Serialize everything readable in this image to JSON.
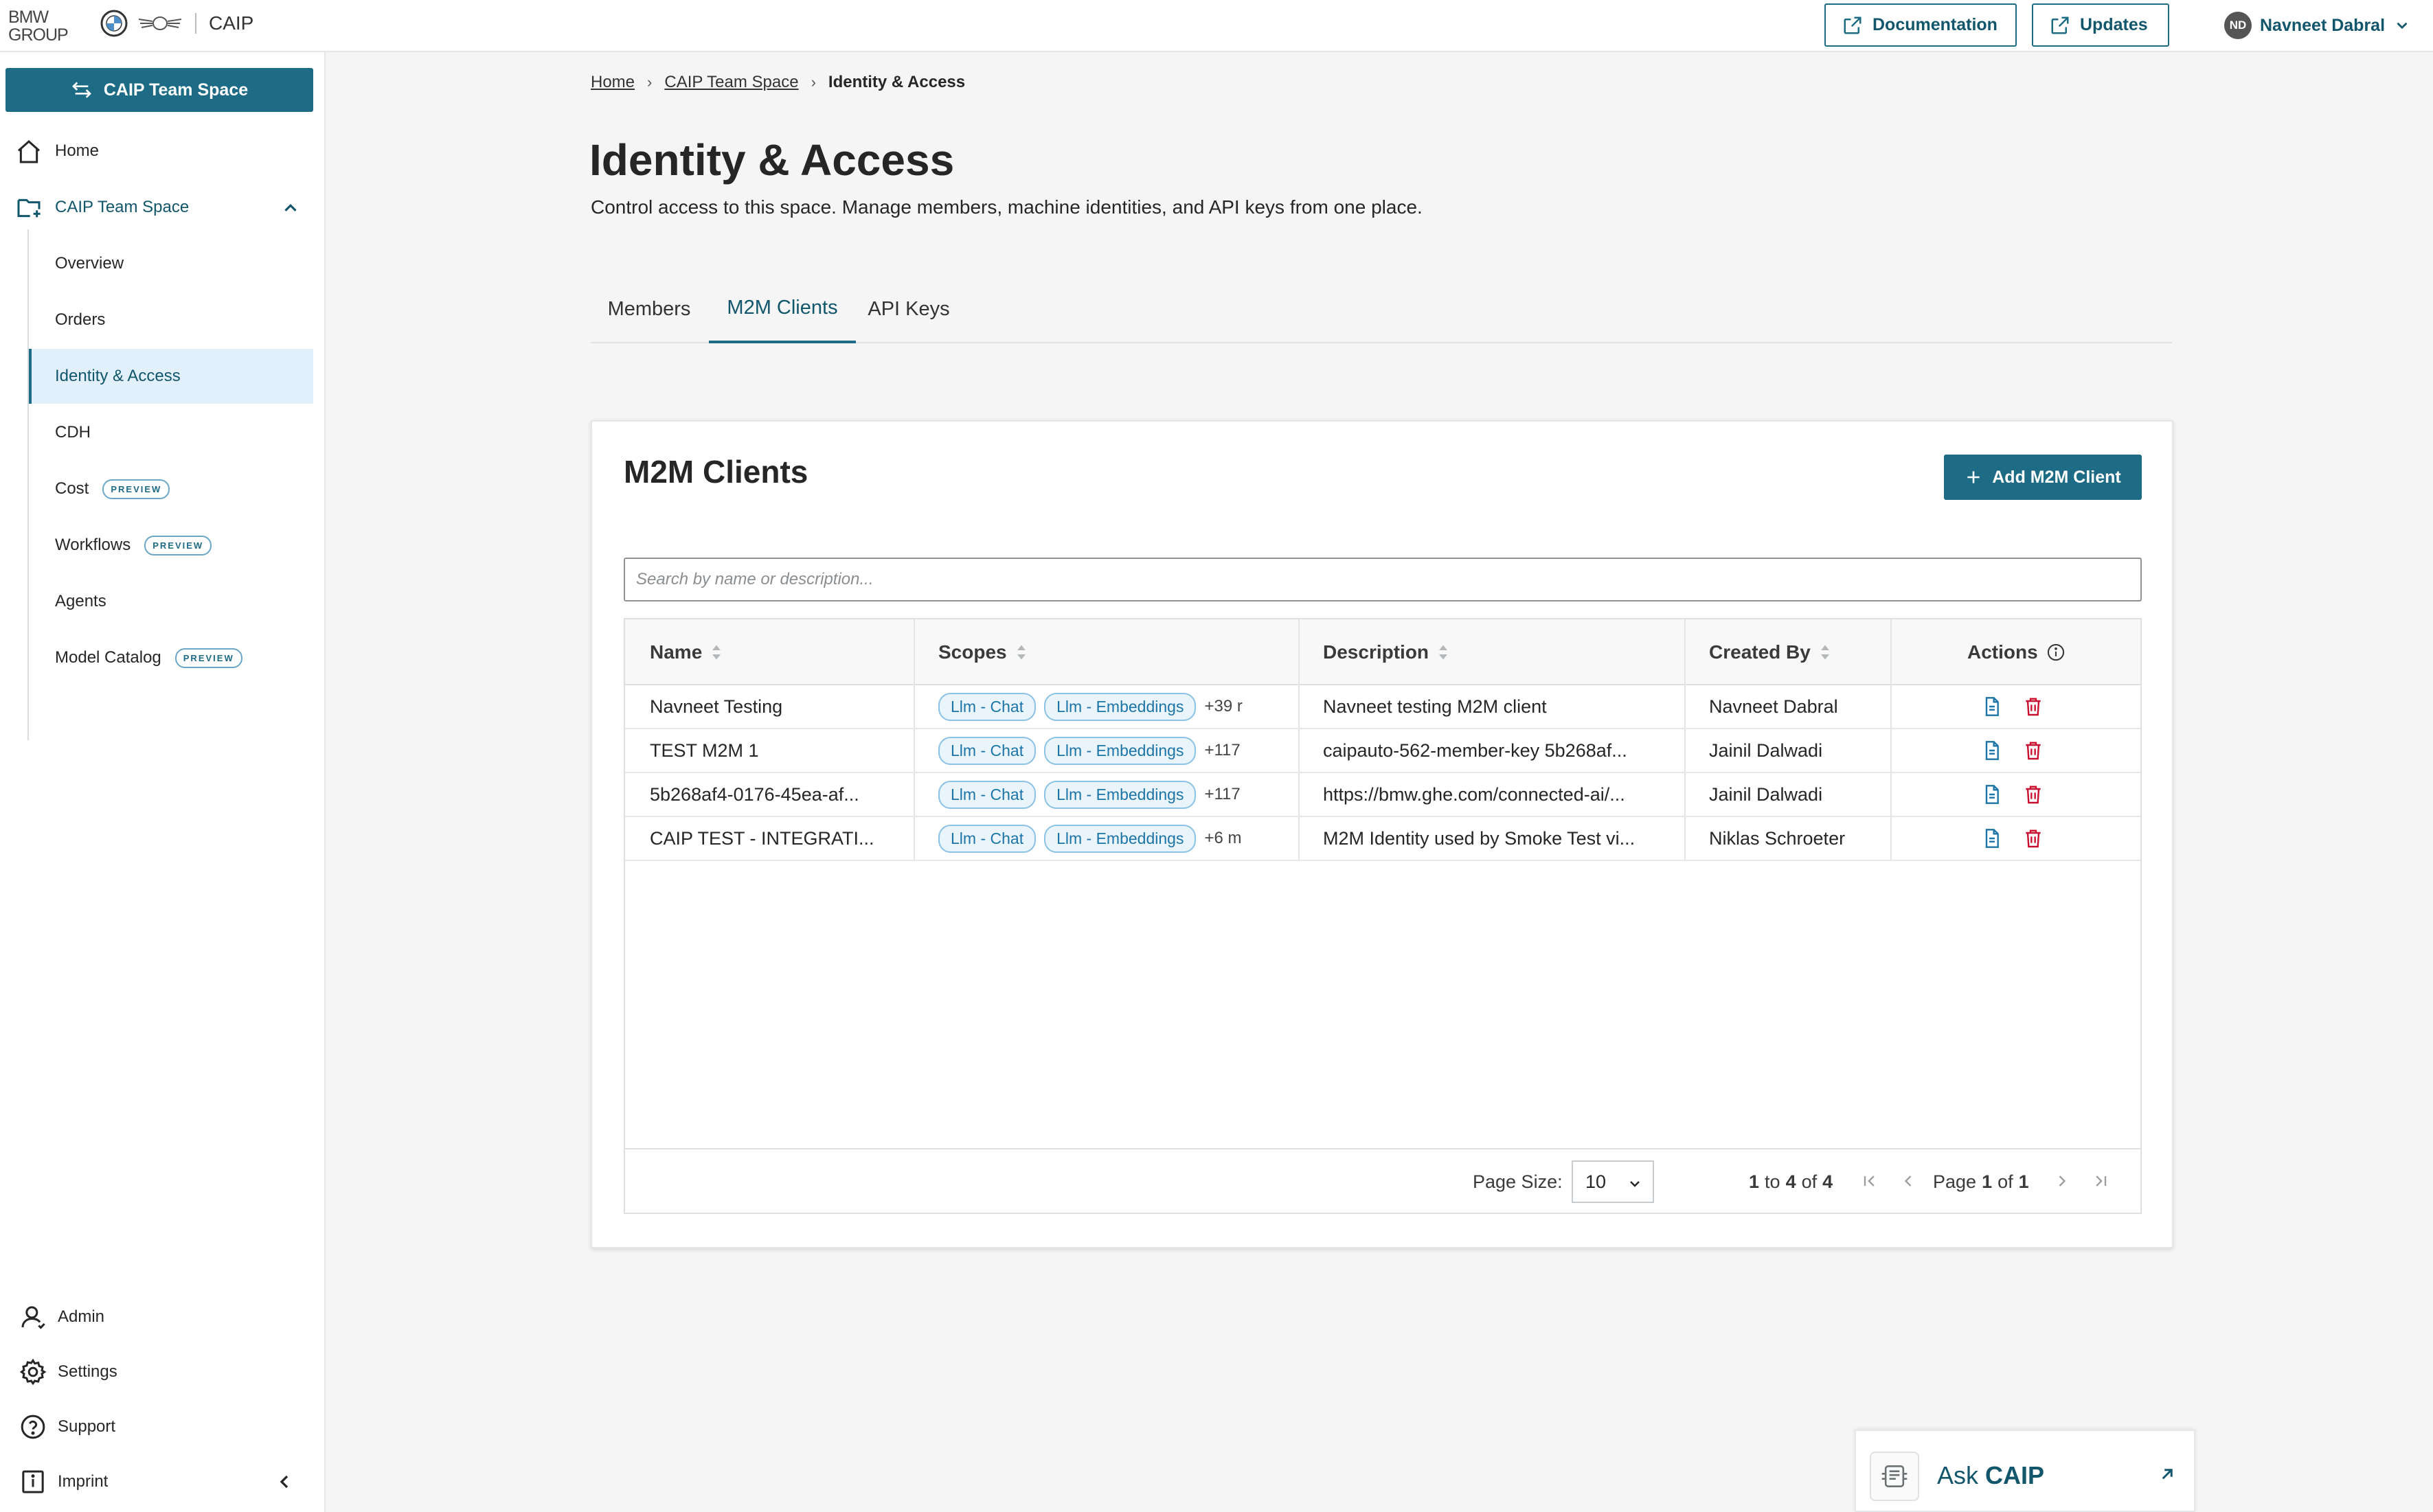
{
  "brand": {
    "group_line1": "BMW",
    "group_line2": "GROUP",
    "app_name": "CAIP"
  },
  "header": {
    "documentation_label": "Documentation",
    "updates_label": "Updates",
    "user_initials": "ND",
    "user_name": "Navneet Dabral"
  },
  "sidebar": {
    "space_button_label": "CAIP Team Space",
    "home_label": "Home",
    "space_label": "CAIP Team Space",
    "sub_items": [
      {
        "label": "Overview",
        "badge": ""
      },
      {
        "label": "Orders",
        "badge": ""
      },
      {
        "label": "Identity & Access",
        "badge": ""
      },
      {
        "label": "CDH",
        "badge": ""
      },
      {
        "label": "Cost",
        "badge": "PREVIEW"
      },
      {
        "label": "Workflows",
        "badge": "PREVIEW"
      },
      {
        "label": "Agents",
        "badge": ""
      },
      {
        "label": "Model Catalog",
        "badge": "PREVIEW"
      }
    ],
    "active_item": "Identity & Access",
    "bottom_items": [
      {
        "label": "Admin",
        "icon": "user-icon"
      },
      {
        "label": "Settings",
        "icon": "gear-icon"
      },
      {
        "label": "Support",
        "icon": "help-icon"
      },
      {
        "label": "Imprint",
        "icon": "imprint-icon"
      }
    ]
  },
  "breadcrumb": {
    "items": [
      "Home",
      "CAIP Team Space"
    ],
    "current": "Identity & Access"
  },
  "page": {
    "title": "Identity & Access",
    "description": "Control access to this space. Manage members, machine identities, and API keys from one place."
  },
  "tabs": [
    {
      "label": "Members",
      "active": false
    },
    {
      "label": "M2M Clients",
      "active": true
    },
    {
      "label": "API Keys",
      "active": false
    }
  ],
  "m2m": {
    "title": "M2M Clients",
    "add_button_label": "Add M2M Client",
    "search_placeholder": "Search by name or description...",
    "columns": {
      "name": "Name",
      "scopes": "Scopes",
      "description": "Description",
      "created_by": "Created By",
      "actions": "Actions"
    },
    "rows": [
      {
        "name": "Navneet Testing",
        "scopes": [
          "Llm - Chat",
          "Llm - Embeddings"
        ],
        "more": "+39 r",
        "description": "Navneet testing M2M client",
        "created_by": "Navneet Dabral"
      },
      {
        "name": "TEST M2M 1",
        "scopes": [
          "Llm - Chat",
          "Llm - Embeddings"
        ],
        "more": "+117",
        "description": "caipauto-562-member-key 5b268af...",
        "created_by": "Jainil Dalwadi"
      },
      {
        "name": "5b268af4-0176-45ea-af...",
        "scopes": [
          "Llm - Chat",
          "Llm - Embeddings"
        ],
        "more": "+117",
        "description": "https://bmw.ghe.com/connected-ai/...",
        "created_by": "Jainil Dalwadi"
      },
      {
        "name": "CAIP TEST - INTEGRATI...",
        "scopes": [
          "Llm - Chat",
          "Llm - Embeddings"
        ],
        "more": "+6 m",
        "description": "M2M Identity used by Smoke Test vi...",
        "created_by": "Niklas Schroeter"
      }
    ],
    "pagination": {
      "page_size_label": "Page Size:",
      "page_size": "10",
      "range_from": "1",
      "range_to_label": "to",
      "range_to": "4",
      "range_of_label": "of",
      "range_total": "4",
      "page_label": "Page",
      "page": "1",
      "page_of_label": "of",
      "page_total": "1"
    }
  },
  "ask": {
    "prefix": "Ask",
    "name": "CAIP"
  },
  "colors": {
    "primary": "#1d6b84",
    "primary_text": "#12566c",
    "danger": "#c8102e",
    "chip_border": "#8ac2e6",
    "chip_bg": "#e9f4fb",
    "active_nav_bg": "#e1f0fa"
  }
}
